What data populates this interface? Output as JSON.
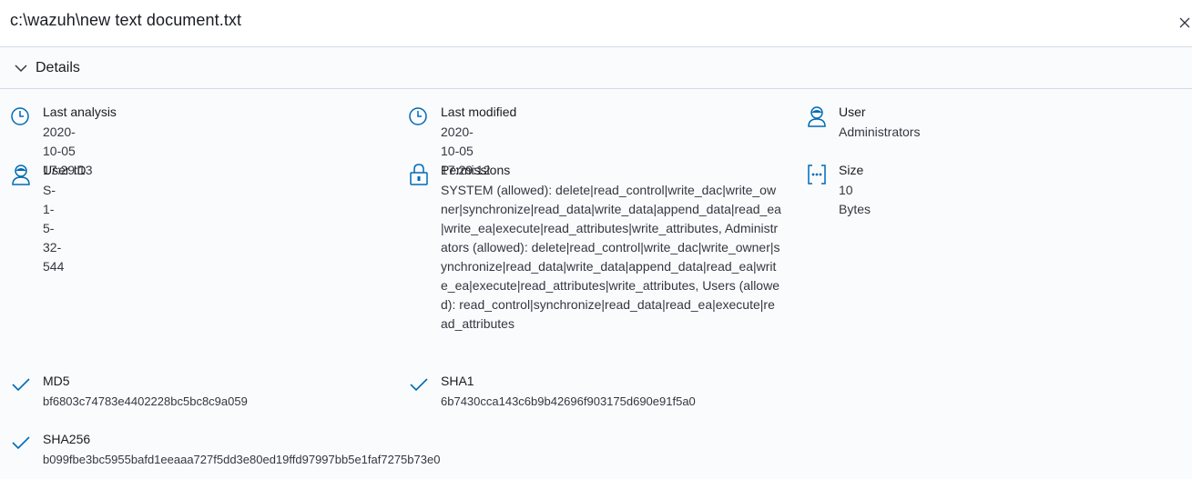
{
  "flyout": {
    "title": "c:\\wazuh\\new text document.txt"
  },
  "accordion": {
    "label": "Details"
  },
  "details": {
    "last_analysis": {
      "label": "Last analysis",
      "value": "2020-10-05 17:29:13"
    },
    "last_modified": {
      "label": "Last modified",
      "value": "2020-10-05 17:29:12"
    },
    "user": {
      "label": "User",
      "value": "Administrators"
    },
    "user_id": {
      "label": "User ID",
      "value": "S-1-5-32-544"
    },
    "permissions": {
      "label": "Permissions",
      "value": "SYSTEM (allowed): delete|read_control|write_dac|write_owner|synchronize|read_data|write_data|append_data|read_ea|write_ea|execute|read_attributes|write_attributes, Administrators (allowed): delete|read_control|write_dac|write_owner|synchronize|read_data|write_data|append_data|read_ea|write_ea|execute|read_attributes|write_attributes, Users (allowed): read_control|synchronize|read_data|read_ea|execute|read_attributes"
    },
    "size": {
      "label": "Size",
      "value": "10 Bytes"
    },
    "md5": {
      "label": "MD5",
      "value": "bf6803c74783e4402228bc5bc8c9a059"
    },
    "sha1": {
      "label": "SHA1",
      "value": "6b7430cca143c6b9b42696f903175d690e91f5a0"
    },
    "sha256": {
      "label": "SHA256",
      "value": "b099fbe3bc5955bafd1eeaaa727f5dd3e80ed19ffd97997bb5e1faf7275b73e0"
    }
  },
  "icons": {
    "close": "close-icon",
    "chevron": "chevron-down-icon",
    "clock": "clock-icon",
    "user": "user-icon",
    "lock": "lock-icon",
    "size": "size-icon",
    "check": "check-icon"
  },
  "colors": {
    "icon_blue": "#006bb4",
    "border": "#d3dae6",
    "panel_bg": "#fafbfd"
  }
}
